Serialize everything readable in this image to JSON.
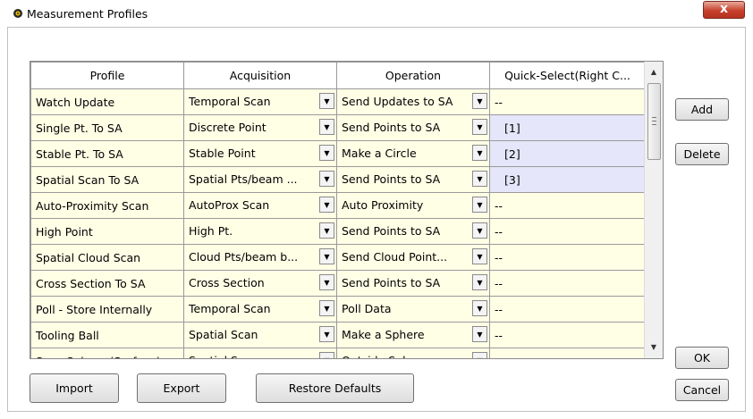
{
  "window": {
    "title": "Measurement Profiles",
    "close_label": "x"
  },
  "grid": {
    "columns": [
      "Profile",
      "Acquisition",
      "Operation",
      "Quick-Select(Right C..."
    ],
    "rows": [
      {
        "profile": "Watch Update",
        "acquisition": "Temporal Scan",
        "operation": "Send Updates to SA",
        "quick_select": "--",
        "qs_active": false
      },
      {
        "profile": "Single Pt. To SA",
        "acquisition": "Discrete Point",
        "operation": "Send Points to SA",
        "quick_select": "[1]",
        "qs_active": true
      },
      {
        "profile": "Stable Pt. To SA",
        "acquisition": "Stable Point",
        "operation": "Make a Circle",
        "quick_select": "[2]",
        "qs_active": true
      },
      {
        "profile": "Spatial Scan To SA",
        "acquisition": "Spatial Pts/beam ...",
        "operation": "Send Points to SA",
        "quick_select": "[3]",
        "qs_active": true
      },
      {
        "profile": "Auto-Proximity Scan",
        "acquisition": "AutoProx Scan",
        "operation": "Auto Proximity",
        "quick_select": "--",
        "qs_active": false
      },
      {
        "profile": "High Point",
        "acquisition": "High Pt.",
        "operation": "Send Points to SA",
        "quick_select": "--",
        "qs_active": false
      },
      {
        "profile": "Spatial Cloud Scan",
        "acquisition": "Cloud Pts/beam b...",
        "operation": "Send Cloud Point...",
        "quick_select": "--",
        "qs_active": false
      },
      {
        "profile": "Cross Section To SA",
        "acquisition": "Cross Section",
        "operation": "Send Points to SA",
        "quick_select": "--",
        "qs_active": false
      },
      {
        "profile": "Poll - Store Internally",
        "acquisition": "Temporal Scan",
        "operation": "Poll Data",
        "quick_select": "--",
        "qs_active": false
      },
      {
        "profile": "Tooling Ball",
        "acquisition": "Spatial Scan",
        "operation": "Make a Sphere",
        "quick_select": "--",
        "qs_active": false
      },
      {
        "profile": "Scan Sphere (Surface)",
        "acquisition": "Spatial Scan",
        "operation": "Outside Sphere",
        "quick_select": "",
        "qs_active": false
      }
    ],
    "scroll_fraction": 0.0
  },
  "buttons": {
    "add": "Add",
    "delete": "Delete",
    "ok": "OK",
    "cancel": "Cancel",
    "import": "Import",
    "export": "Export",
    "restore": "Restore Defaults"
  },
  "colors": {
    "cell_bg": "#ffffe6",
    "quick_select_active_bg": "#e6e6fa",
    "close_button": "#c7412c"
  },
  "icons": {
    "app": "app-icon",
    "dropdown": "chevron-down-icon",
    "scroll_up": "arrow-up-icon",
    "scroll_down": "arrow-down-icon"
  }
}
